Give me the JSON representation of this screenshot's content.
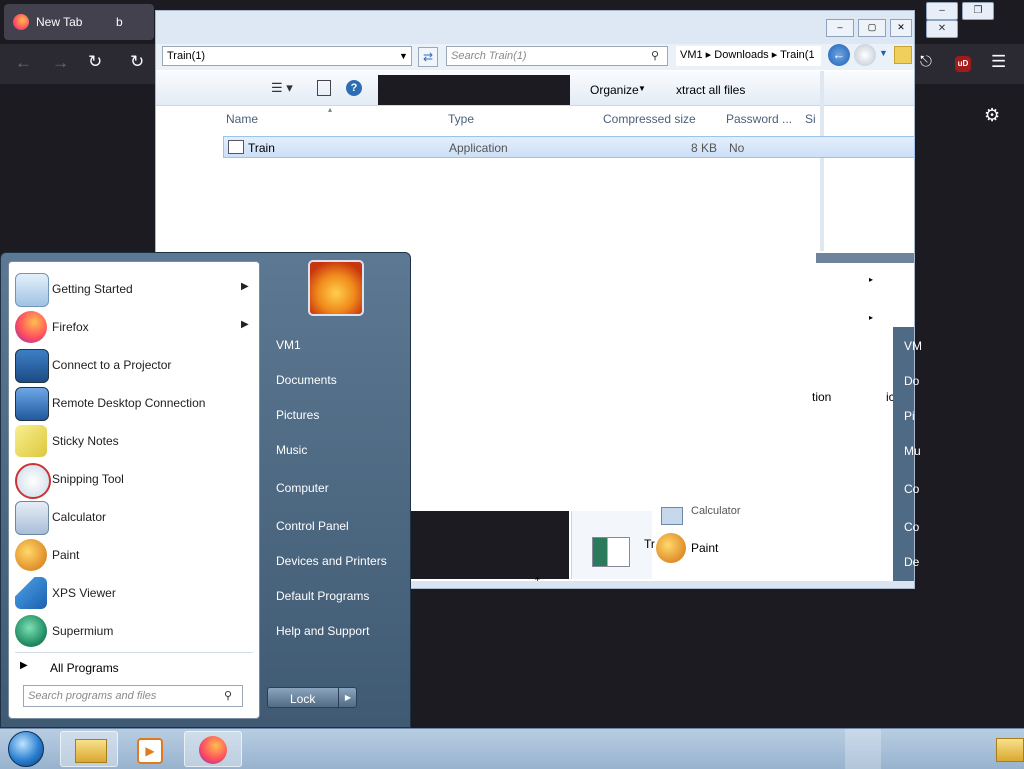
{
  "firefox": {
    "tab_title": "New Tab",
    "tab_title_2": "b"
  },
  "explorer": {
    "address_value": "Train(1)",
    "search_placeholder": "Search Train(1)",
    "breadcrumb": [
      "VM1",
      "Downloads",
      "Train(1"
    ],
    "organize_label": "Organize",
    "extract_label": "xtract all files",
    "columns": [
      "Name",
      "Type",
      "Compressed size",
      "Password ...",
      "Si"
    ],
    "row": {
      "name": "Train",
      "type": "Application",
      "size": "8 KB",
      "password": "No"
    }
  },
  "ghost": {
    "right_items": [
      "VM",
      "Do",
      "Pi",
      "Mu",
      "Co",
      "Co",
      "De"
    ],
    "tion": "tion",
    "ic": "ic",
    "calculator": "Calculator",
    "paint": "Paint",
    "tr": "Tr"
  },
  "start_menu": {
    "programs": [
      {
        "label": "Getting Started",
        "arrow": true
      },
      {
        "label": "Firefox",
        "arrow": true
      },
      {
        "label": "Connect to a Projector",
        "arrow": false
      },
      {
        "label": "Remote Desktop Connection",
        "arrow": false
      },
      {
        "label": "Sticky Notes",
        "arrow": false
      },
      {
        "label": "Snipping Tool",
        "arrow": false
      },
      {
        "label": "Calculator",
        "arrow": false
      },
      {
        "label": "Paint",
        "arrow": false
      },
      {
        "label": "XPS Viewer",
        "arrow": false
      },
      {
        "label": "Supermium",
        "arrow": false
      }
    ],
    "all_programs": "All Programs",
    "search_placeholder": "Search programs and files",
    "right_links": [
      "VM1",
      "Documents",
      "Pictures",
      "Music",
      "Computer",
      "Control Panel",
      "Devices and Printers",
      "Default Programs",
      "Help and Support"
    ],
    "lock_label": "Lock"
  },
  "colors": {
    "ff_dark": "#1c1b22",
    "explorer_chrome": "#dde8f4",
    "start_blue": "#4f6a84",
    "taskbar": "#a9c1da"
  }
}
